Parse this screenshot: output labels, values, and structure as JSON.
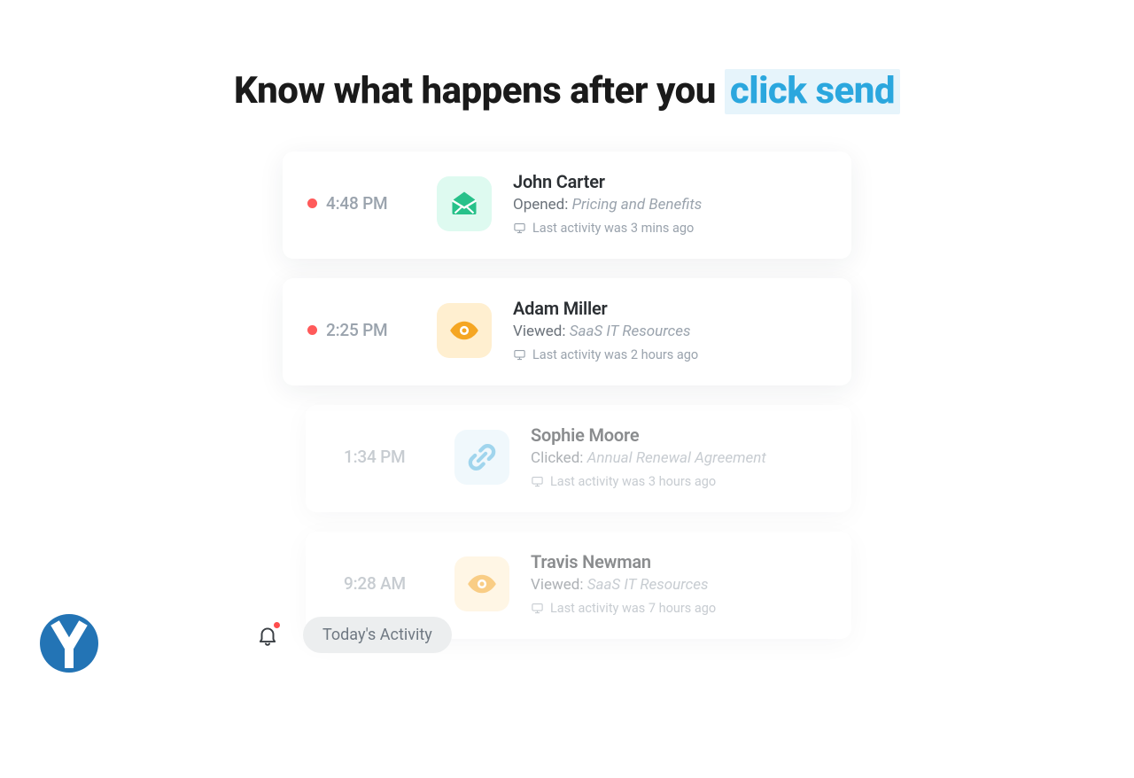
{
  "headline_plain": "Know what happens after you ",
  "headline_highlight": "click send",
  "bottom": {
    "label": "Today's Activity"
  },
  "cards": [
    {
      "time": "4:48 PM",
      "unread": true,
      "faded": false,
      "icon": "envelope",
      "tile_class": "tile-green",
      "name": "John Carter",
      "action_label": "Opened:",
      "subject": "Pricing and Benefits",
      "meta": "Last activity was 3 mins ago"
    },
    {
      "time": "2:25 PM",
      "unread": true,
      "faded": false,
      "icon": "eye",
      "tile_class": "tile-yellow",
      "name": "Adam Miller",
      "action_label": "Viewed:",
      "subject": "SaaS IT Resources",
      "meta": "Last activity was 2 hours ago"
    },
    {
      "time": "1:34 PM",
      "unread": false,
      "faded": true,
      "icon": "link",
      "tile_class": "tile-blue",
      "name": "Sophie Moore",
      "action_label": "Clicked:",
      "subject": "Annual Renewal Agreement",
      "meta": "Last activity was 3 hours ago"
    },
    {
      "time": "9:28 AM",
      "unread": false,
      "faded": true,
      "icon": "eye",
      "tile_class": "tile-yellow",
      "name": "Travis Newman",
      "action_label": "Viewed:",
      "subject": "SaaS IT Resources",
      "meta": "Last activity was 7 hours ago"
    }
  ]
}
